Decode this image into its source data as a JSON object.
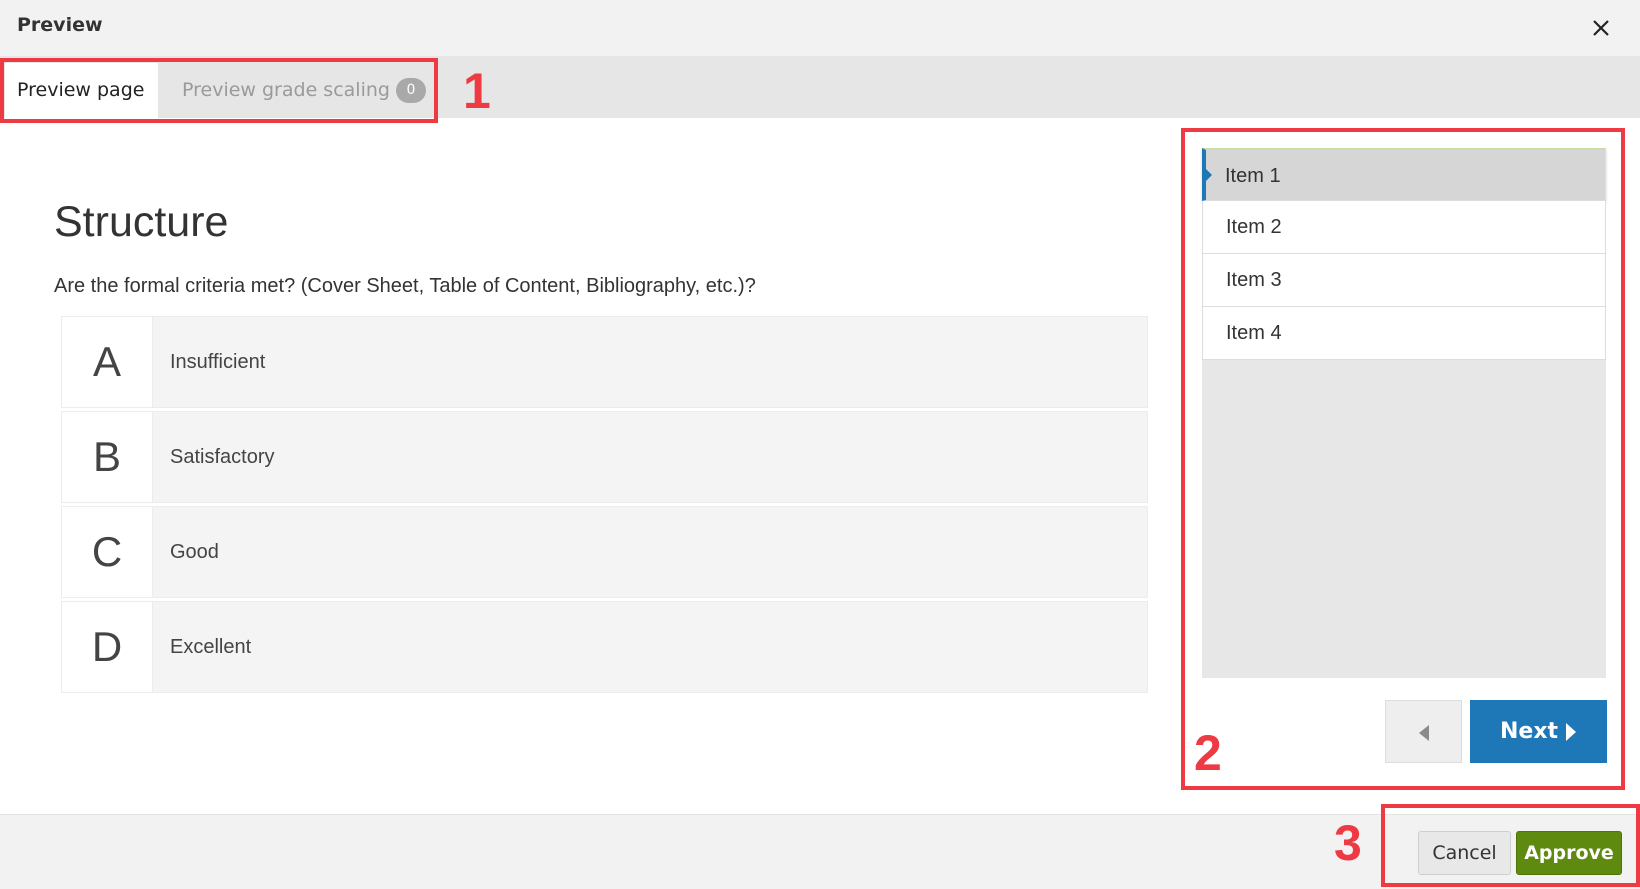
{
  "window": {
    "title": "Preview"
  },
  "tabs": [
    {
      "label": "Preview page",
      "active": true
    },
    {
      "label": "Preview grade scaling",
      "badge": "0",
      "active": false
    }
  ],
  "content": {
    "heading": "Structure",
    "question": "Are the formal criteria met? (Cover Sheet, Table of Content, Bibliography, etc.)?",
    "options": [
      {
        "letter": "A",
        "label": "Insufficient"
      },
      {
        "letter": "B",
        "label": "Satisfactory"
      },
      {
        "letter": "C",
        "label": "Good"
      },
      {
        "letter": "D",
        "label": "Excellent"
      }
    ]
  },
  "navigator": {
    "items": [
      "Item 1",
      "Item 2",
      "Item 3",
      "Item 4"
    ],
    "current_index": 0,
    "next_label": "Next"
  },
  "footer": {
    "cancel_label": "Cancel",
    "approve_label": "Approve"
  },
  "annotations": [
    "1",
    "2",
    "3"
  ],
  "colors": {
    "accent_blue": "#1e78b8",
    "approve_green": "#5f8a10",
    "annotation_red": "#ee3a43"
  }
}
